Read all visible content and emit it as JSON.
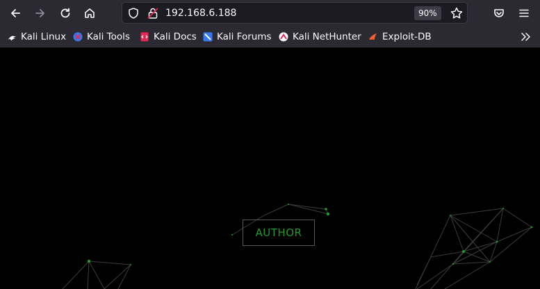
{
  "browser": {
    "url": "192.168.6.188",
    "zoom": "90%",
    "bookmarks": [
      {
        "label": "Kali Linux",
        "icon": "kali-dragon-icon"
      },
      {
        "label": "Kali Tools",
        "icon": "kali-tools-icon"
      },
      {
        "label": "Kali Docs",
        "icon": "kali-docs-icon"
      },
      {
        "label": "Kali Forums",
        "icon": "kali-forums-icon"
      },
      {
        "label": "Kali NetHunter",
        "icon": "kali-nethunter-icon"
      },
      {
        "label": "Exploit-DB",
        "icon": "exploit-db-icon"
      }
    ]
  },
  "page": {
    "button_label": "AUTHOR",
    "background": "#000000",
    "accent": "#1f9b2a"
  }
}
